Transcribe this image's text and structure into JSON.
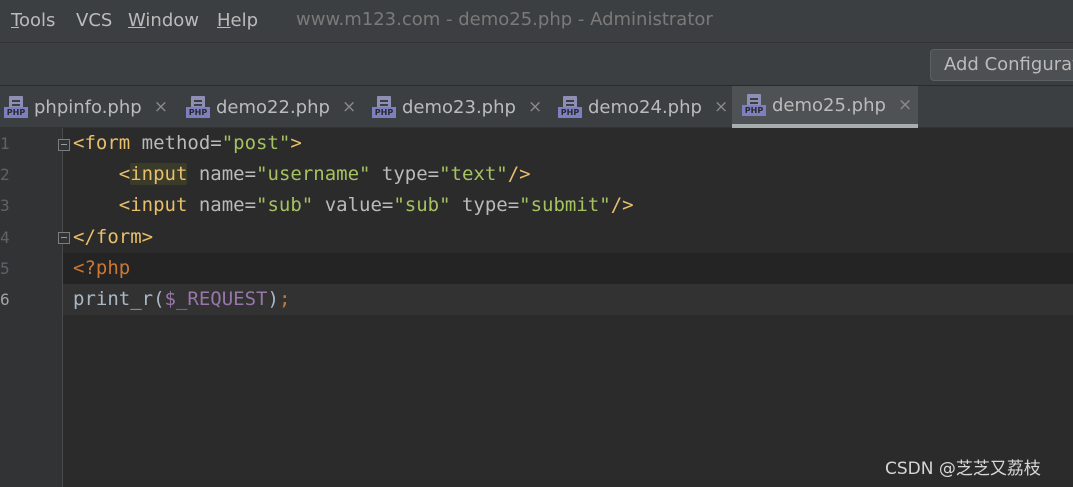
{
  "menu": {
    "items": [
      {
        "label": "Tools",
        "mnemonic": "T",
        "rest": "ools"
      },
      {
        "label": "VCS",
        "mnemonic": "",
        "rest": "VCS"
      },
      {
        "label": "Window",
        "mnemonic": "W",
        "rest": "indow"
      },
      {
        "label": "Help",
        "mnemonic": "H",
        "rest": "elp"
      }
    ]
  },
  "window_title": "www.m123.com - demo25.php - Administrator",
  "toolbar": {
    "add_configuration_label": "Add Configurat"
  },
  "tabs": [
    {
      "label": "phpinfo.php",
      "icon": "php-file-icon",
      "active": false
    },
    {
      "label": "demo22.php",
      "icon": "php-file-icon",
      "active": false
    },
    {
      "label": "demo23.php",
      "icon": "php-file-icon",
      "active": false
    },
    {
      "label": "demo24.php",
      "icon": "php-file-icon",
      "active": false
    },
    {
      "label": "demo25.php",
      "icon": "php-file-icon",
      "active": true
    }
  ],
  "tab_icon_text": "PHP",
  "tab_close_glyph": "×",
  "editor": {
    "line_numbers": [
      "1",
      "2",
      "3",
      "4",
      "5",
      "6"
    ],
    "current_line": "6",
    "lines": [
      [
        {
          "t": "<form",
          "c": "tag"
        },
        {
          "t": " method=",
          "c": "attr"
        },
        {
          "t": "\"post\"",
          "c": "str"
        },
        {
          "t": ">",
          "c": "tag"
        }
      ],
      [
        {
          "t": "    ",
          "c": "punc"
        },
        {
          "t": "<",
          "c": "tag"
        },
        {
          "t": "input",
          "c": "tag",
          "match": true
        },
        {
          "t": " name=",
          "c": "attr"
        },
        {
          "t": "\"username\"",
          "c": "str"
        },
        {
          "t": " type=",
          "c": "attr"
        },
        {
          "t": "\"text\"",
          "c": "str"
        },
        {
          "t": "/>",
          "c": "tag"
        }
      ],
      [
        {
          "t": "    ",
          "c": "punc"
        },
        {
          "t": "<input",
          "c": "tag"
        },
        {
          "t": " name=",
          "c": "attr"
        },
        {
          "t": "\"sub\"",
          "c": "str"
        },
        {
          "t": " value=",
          "c": "attr"
        },
        {
          "t": "\"sub\"",
          "c": "str"
        },
        {
          "t": " type=",
          "c": "attr"
        },
        {
          "t": "\"submit\"",
          "c": "str"
        },
        {
          "t": "/>",
          "c": "tag"
        }
      ],
      [
        {
          "t": "</form>",
          "c": "tag"
        }
      ],
      [
        {
          "t": "<?php",
          "c": "php"
        }
      ],
      [
        {
          "t": "print_r",
          "c": "fn"
        },
        {
          "t": "(",
          "c": "punc"
        },
        {
          "t": "$_REQUEST",
          "c": "var"
        },
        {
          "t": ")",
          "c": "punc"
        },
        {
          "t": ";",
          "c": "semi"
        }
      ]
    ]
  },
  "watermark": "CSDN @芝芝又荔枝",
  "colors": {
    "background": "#2b2b2b",
    "chrome": "#3c3f41",
    "tag": "#e8bf6a",
    "string": "#a5c261",
    "keyword": "#cc7832",
    "variable": "#9876aa"
  }
}
